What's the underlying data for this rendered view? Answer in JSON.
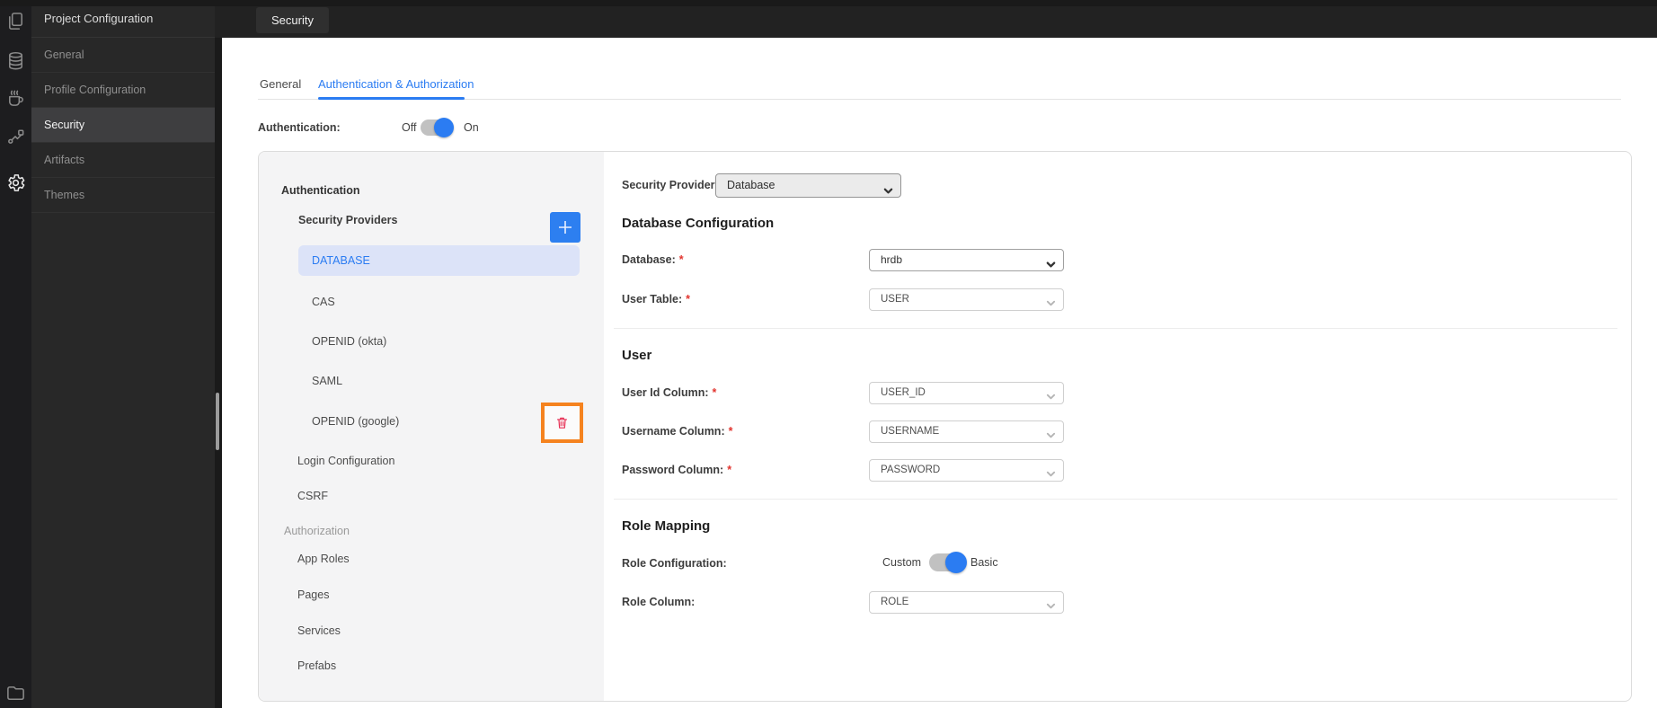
{
  "colors": {
    "accent": "#2b7cf2",
    "selected_item_bg": "#dce3f8",
    "highlight_orange": "#f5831f",
    "trash_red": "#e73055",
    "toggle_track": "#c1c1c1"
  },
  "activity_bar": {
    "icons": [
      {
        "name": "pages"
      },
      {
        "name": "database"
      },
      {
        "name": "java-services"
      },
      {
        "name": "apis"
      },
      {
        "name": "settings",
        "active": true
      }
    ],
    "bottom_icon": "file-explorer"
  },
  "sidebar": {
    "title": "Project Configuration",
    "items": [
      {
        "label": "General"
      },
      {
        "label": "Profile Configuration"
      },
      {
        "label": "Security",
        "active": true
      },
      {
        "label": "Artifacts"
      },
      {
        "label": "Themes"
      }
    ]
  },
  "topbar": {
    "tab": "Security"
  },
  "tabs": {
    "general": "General",
    "auth": "Authentication & Authorization"
  },
  "auth_row": {
    "label": "Authentication:",
    "off": "Off",
    "on": "On",
    "state": "on"
  },
  "nav": {
    "section_authentication": "Authentication",
    "providers_header": "Security Providers",
    "providers": [
      {
        "label": "DATABASE",
        "selected": true
      },
      {
        "label": "CAS"
      },
      {
        "label": "OPENID (okta)"
      },
      {
        "label": "SAML"
      },
      {
        "label": "OPENID (google)"
      }
    ],
    "items": [
      {
        "label": "Login Configuration"
      },
      {
        "label": "CSRF"
      }
    ],
    "section_authorization": "Authorization",
    "authorization_items": [
      {
        "label": "App Roles"
      },
      {
        "label": "Pages"
      },
      {
        "label": "Services"
      },
      {
        "label": "Prefabs"
      }
    ]
  },
  "form": {
    "required_marker": "*",
    "security_provider_label": "Security Provider",
    "security_provider_value": "Database",
    "db_section_heading": "Database Configuration",
    "database_label": "Database:",
    "database_value": "hrdb",
    "user_table_label": "User Table:",
    "user_table_value": "USER",
    "user_section_heading": "User",
    "user_id_label": "User Id Column:",
    "user_id_value": "USER_ID",
    "username_label": "Username Column:",
    "username_value": "USERNAME",
    "password_label": "Password Column:",
    "password_value": "PASSWORD",
    "role_section_heading": "Role Mapping",
    "role_config_label": "Role Configuration:",
    "role_custom": "Custom",
    "role_basic": "Basic",
    "role_column_label": "Role Column:",
    "role_column_value": "ROLE"
  }
}
